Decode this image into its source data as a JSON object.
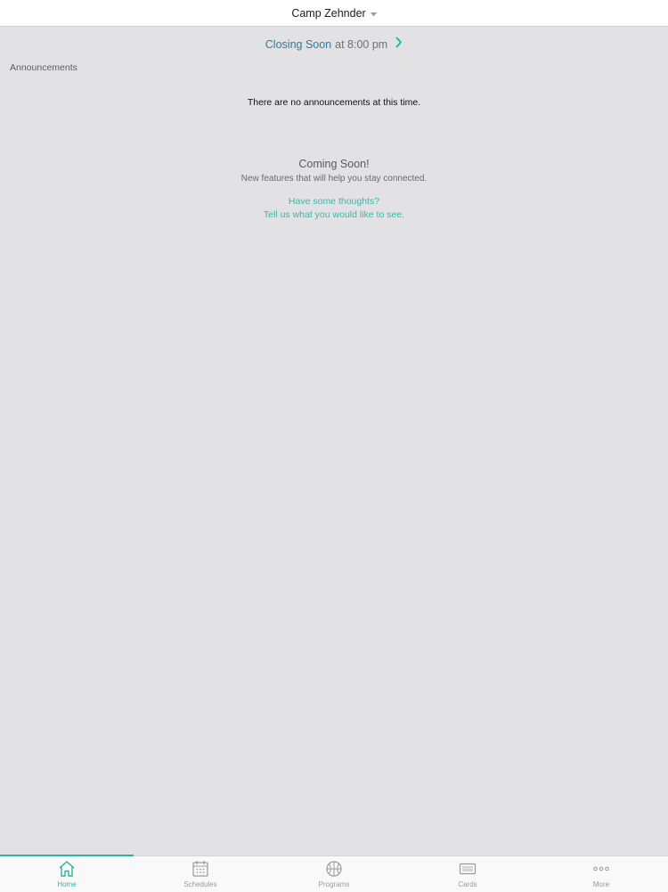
{
  "header": {
    "location": "Camp Zehnder",
    "dropdown_icon": "caret-down-icon"
  },
  "status": {
    "label": "Closing Soon",
    "time": "at 8:00 pm",
    "arrow_icon": "chevron-right-icon"
  },
  "announcements": {
    "section_label": "Announcements",
    "empty_message": "There are no announcements at this time."
  },
  "coming_soon": {
    "title": "Coming Soon!",
    "subtitle": "New features that will help you stay connected.",
    "link_line1": "Have some thoughts?",
    "link_line2": "Tell us what you would like to see."
  },
  "tabbar": {
    "active_tab": "Home",
    "tabs": [
      {
        "label": "Home",
        "icon": "home-icon"
      },
      {
        "label": "Schedules",
        "icon": "calendar-icon"
      },
      {
        "label": "Programs",
        "icon": "basketball-icon"
      },
      {
        "label": "Cards",
        "icon": "card-icon"
      },
      {
        "label": "More",
        "icon": "more-icon"
      }
    ]
  },
  "colors": {
    "accent": "#2bb3a6",
    "status_blue": "#2b7f9a",
    "background": "#e2e1e3"
  }
}
